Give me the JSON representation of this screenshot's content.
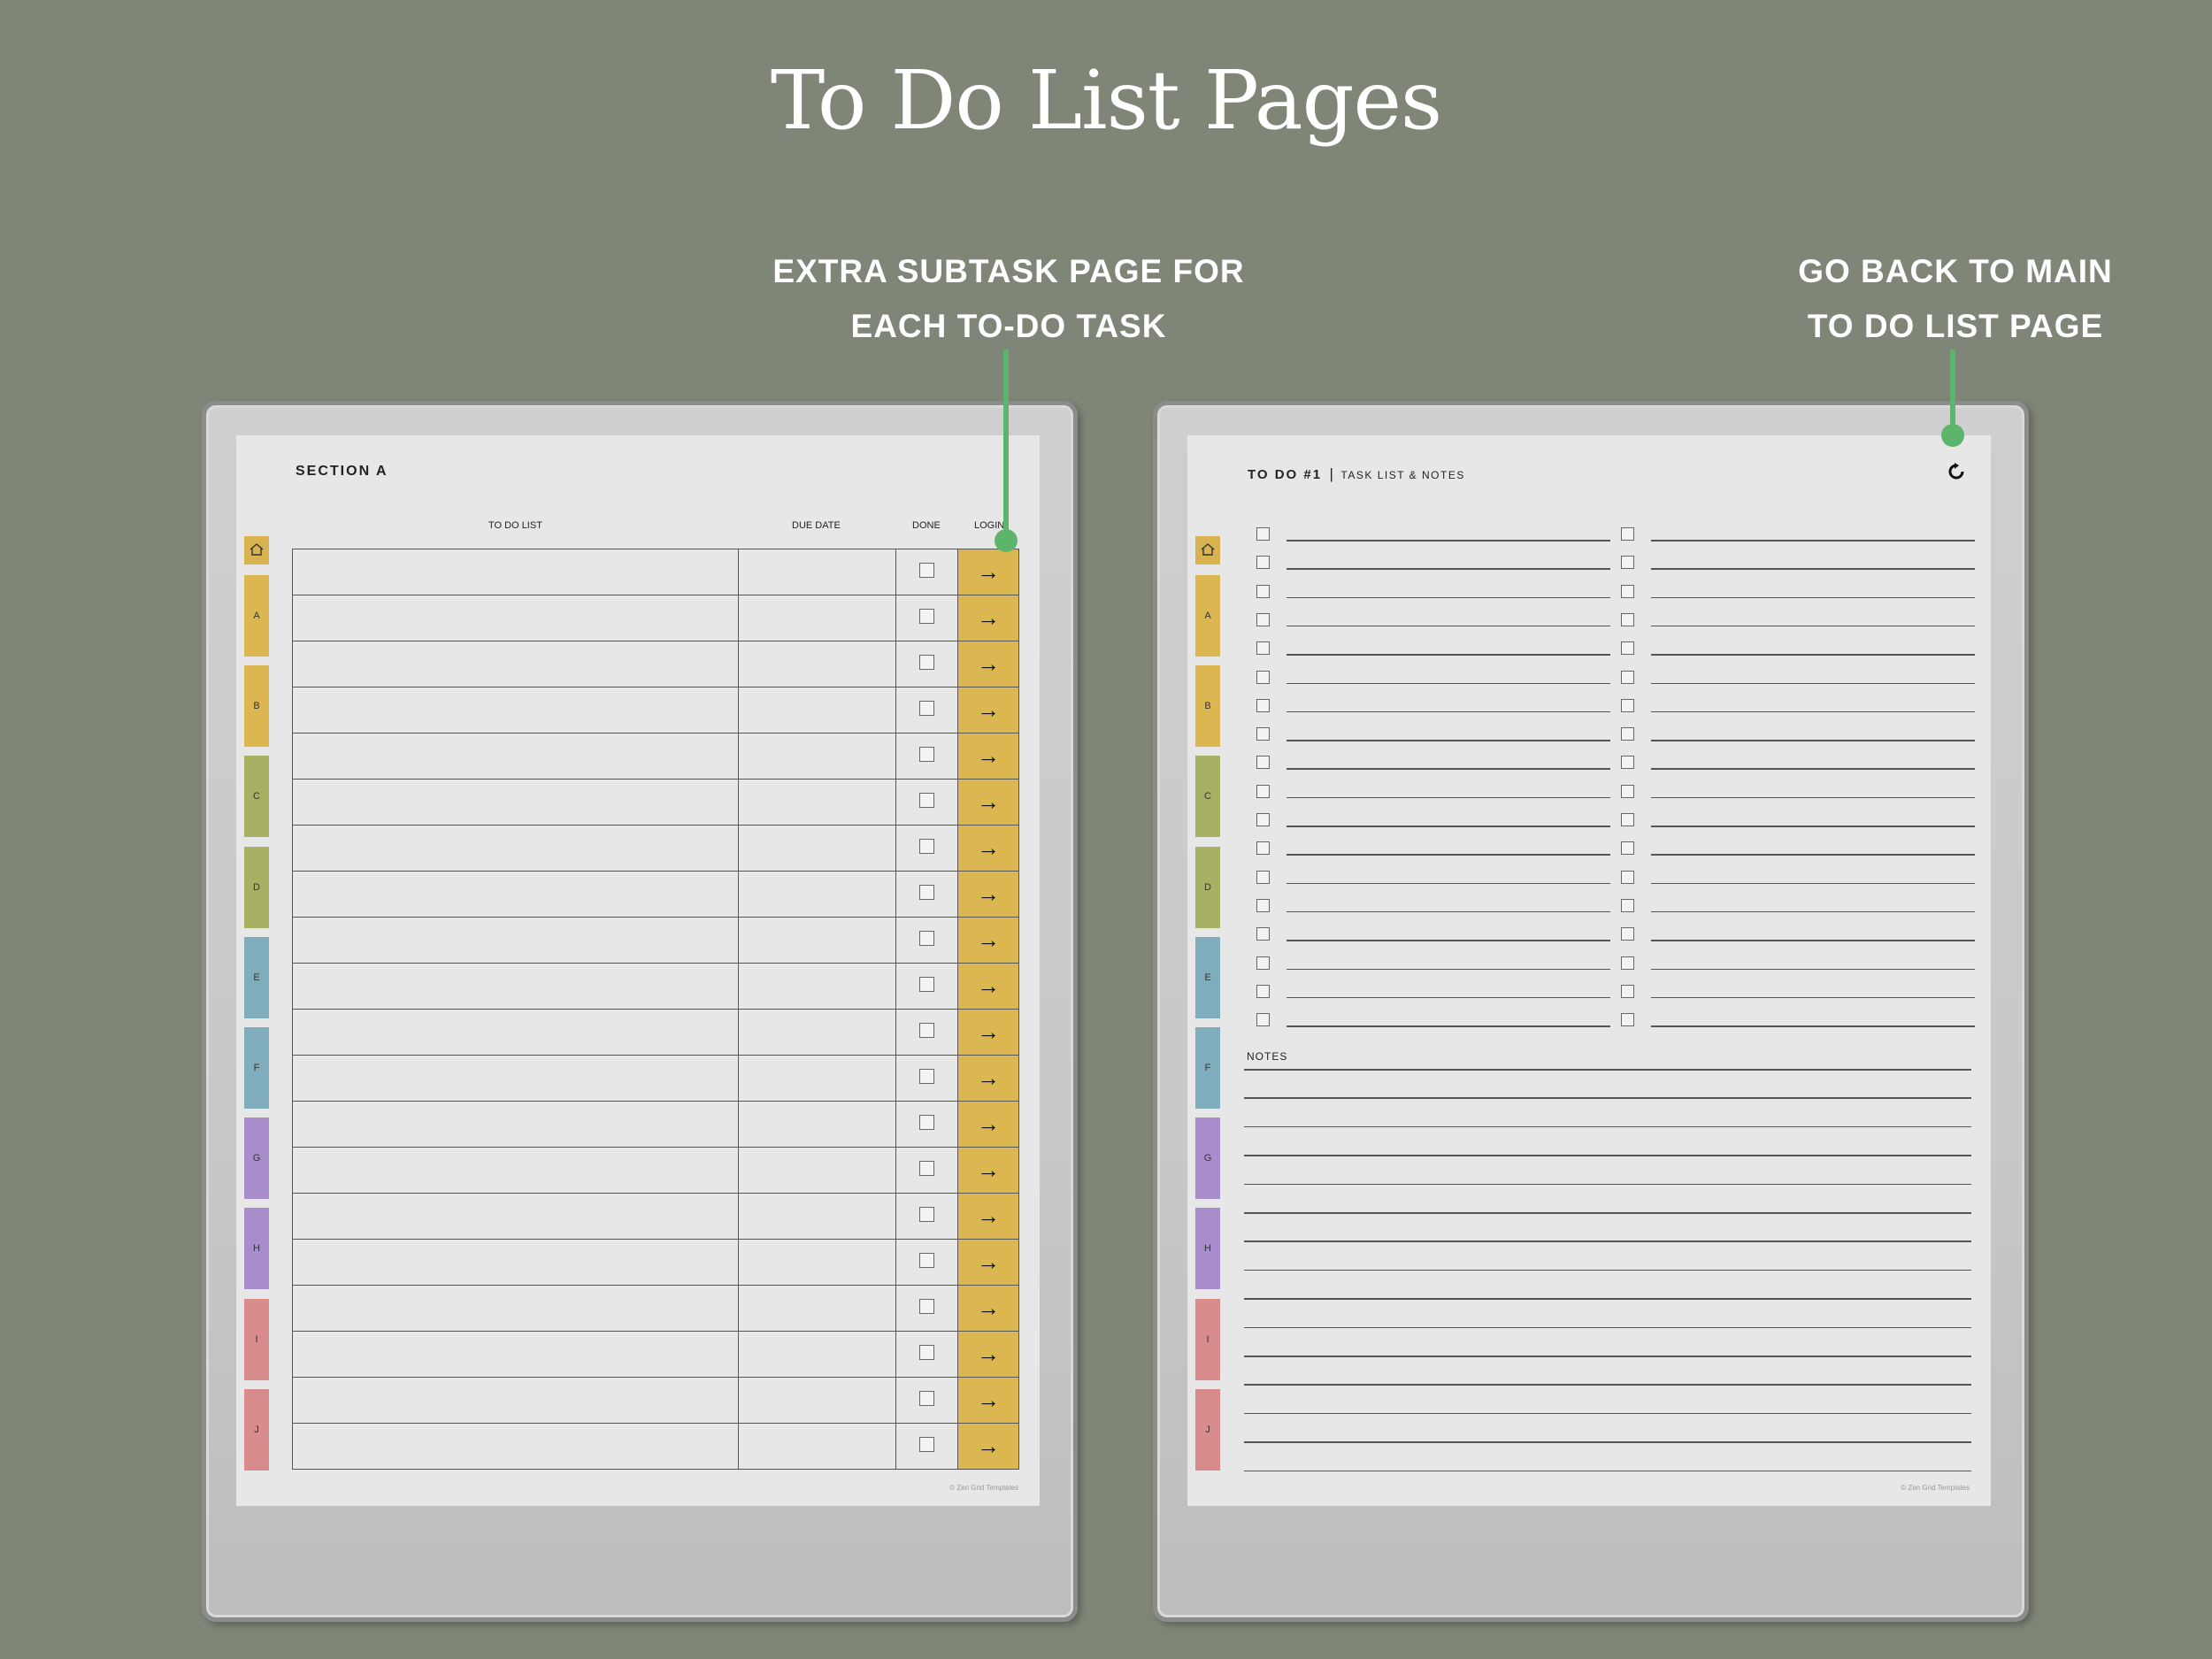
{
  "title": "To Do List Pages",
  "callouts": {
    "left": {
      "line1": "EXTRA SUBTASK PAGE FOR",
      "line2": "EACH TO-DO TASK"
    },
    "right": {
      "line1": "GO BACK TO MAIN",
      "line2": "TO DO LIST PAGE"
    }
  },
  "colors": {
    "background": "#7f8677",
    "pointer": "#5db56c",
    "arrow_column": "#dcb651"
  },
  "tabs": [
    {
      "label": "",
      "icon": "home-icon",
      "color": "#d9b34f"
    },
    {
      "label": "A",
      "color": "#dcb651"
    },
    {
      "label": "B",
      "color": "#dcb651"
    },
    {
      "label": "C",
      "color": "#a8b063"
    },
    {
      "label": "D",
      "color": "#a8b063"
    },
    {
      "label": "E",
      "color": "#7fadbb"
    },
    {
      "label": "F",
      "color": "#7fadbb"
    },
    {
      "label": "G",
      "color": "#a98ccc"
    },
    {
      "label": "H",
      "color": "#a98ccc"
    },
    {
      "label": "I",
      "color": "#d98c8c"
    },
    {
      "label": "J",
      "color": "#d98c8c"
    }
  ],
  "left_page": {
    "section_title": "SECTION A",
    "columns": [
      "TO DO LIST",
      "DUE DATE",
      "DONE",
      "LOGIN"
    ],
    "row_count": 20,
    "arrow_glyph": "→",
    "copyright": "© Zen Grid Templates"
  },
  "right_page": {
    "title_main": "TO DO #1",
    "title_sep": "|",
    "title_sub": "TASK LIST & NOTES",
    "back_icon": "refresh-icon",
    "task_rows": 18,
    "notes_label": "NOTES",
    "notes_lines": 15,
    "copyright": "© Zen Grid Templates"
  }
}
